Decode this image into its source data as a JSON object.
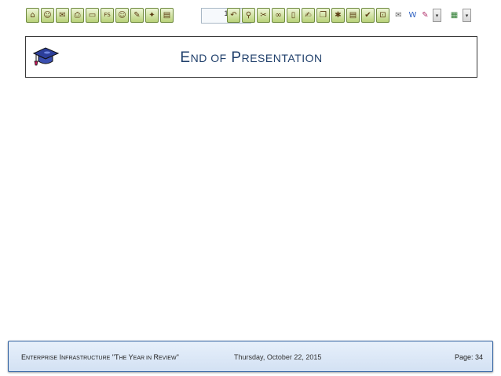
{
  "toolbar": {
    "page_number": "1",
    "buttons_left": [
      {
        "name": "home-icon",
        "glyph": "⌂"
      },
      {
        "name": "back-icon",
        "glyph": "☺"
      },
      {
        "name": "forward-icon",
        "glyph": "✉"
      },
      {
        "name": "print-icon",
        "glyph": "⎙"
      },
      {
        "name": "open-folder-icon",
        "glyph": "▭"
      },
      {
        "name": "fullscreen-icon",
        "glyph": "FS"
      },
      {
        "name": "smiley-icon",
        "glyph": "☺"
      },
      {
        "name": "pen-icon",
        "glyph": "✎"
      },
      {
        "name": "thumbs-up-icon",
        "glyph": "✦"
      },
      {
        "name": "document-icon",
        "glyph": "▤"
      }
    ],
    "buttons_right": [
      {
        "name": "undo-icon",
        "glyph": "↶"
      },
      {
        "name": "binoculars-icon",
        "glyph": "⚲"
      },
      {
        "name": "tools-icon",
        "glyph": "✂"
      },
      {
        "name": "link-icon",
        "glyph": "∞"
      },
      {
        "name": "page-icon",
        "glyph": "▯"
      },
      {
        "name": "edit-page-icon",
        "glyph": "✍"
      },
      {
        "name": "copy-icon",
        "glyph": "❐"
      },
      {
        "name": "pin-icon",
        "glyph": "✱"
      },
      {
        "name": "note-icon",
        "glyph": "▤"
      },
      {
        "name": "checkmark-icon",
        "glyph": "✔"
      },
      {
        "name": "lock-icon",
        "glyph": "⊡"
      }
    ],
    "buttons_extra": [
      {
        "name": "mail-icon",
        "glyph": "✉"
      },
      {
        "name": "word-icon",
        "glyph": "W"
      },
      {
        "name": "attachment-icon",
        "glyph": "✎"
      },
      {
        "name": "excel-icon",
        "glyph": "▦"
      }
    ]
  },
  "title": {
    "first_letter_1": "E",
    "rest_1": "ND OF",
    "first_letter_2": "P",
    "rest_2": "RESENTATION"
  },
  "footer": {
    "left_cap_1": "E",
    "left_rest_1": "NTERPRISE",
    "left_cap_2": "I",
    "left_rest_2": "NFRASTRUCTURE",
    "left_quote_open": "\"T",
    "left_rest_3": "HE",
    "left_cap_4": "Y",
    "left_rest_4": "EAR IN",
    "left_cap_5": "R",
    "left_rest_5": "EVIEW",
    "left_quote_close": "\"",
    "date": "Thursday, October 22, 2015",
    "page": "Page: 34"
  }
}
